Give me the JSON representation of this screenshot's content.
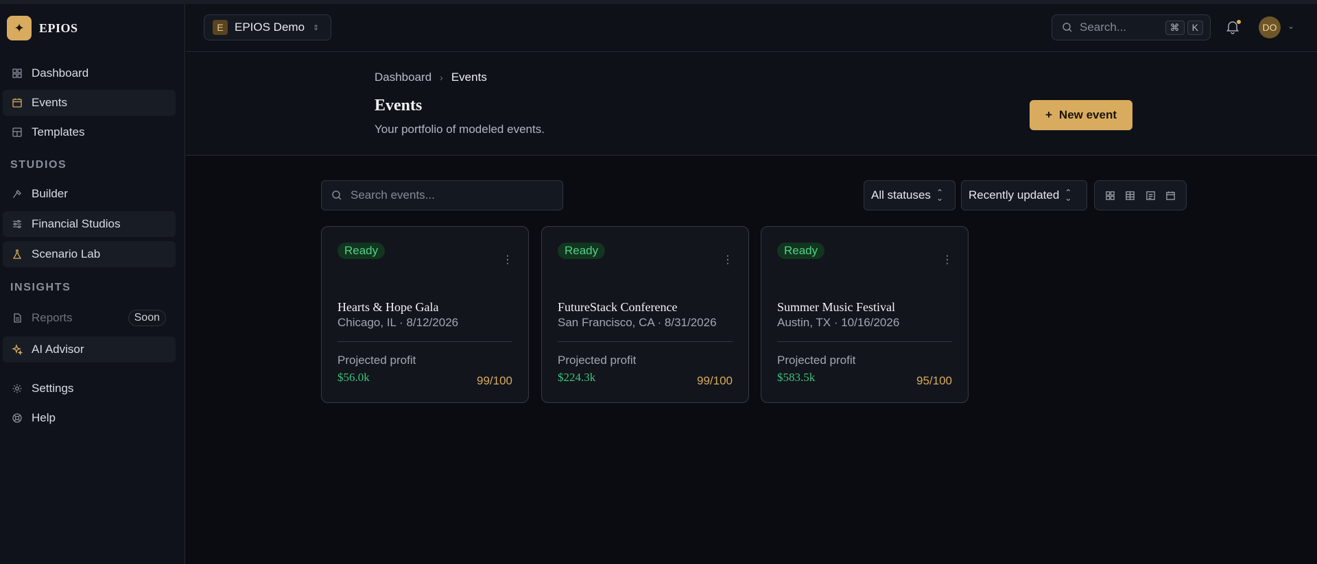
{
  "brand": {
    "logo_glyph": "✦",
    "name": "EPIOS"
  },
  "sidebar": {
    "items_top": [
      {
        "label": "Dashboard",
        "icon": "dashboard-icon"
      },
      {
        "label": "Events",
        "icon": "calendar-icon",
        "active": true
      },
      {
        "label": "Templates",
        "icon": "template-icon"
      }
    ],
    "studios_label": "STUDIOS",
    "studios": [
      {
        "label": "Builder",
        "icon": "hammer-icon"
      },
      {
        "label": "Financial Studios",
        "icon": "sliders-icon",
        "active": true
      },
      {
        "label": "Scenario Lab",
        "icon": "flask-icon",
        "active": true
      }
    ],
    "insights_label": "INSIGHTS",
    "insights": [
      {
        "label": "Reports",
        "icon": "report-icon",
        "badge": "Soon",
        "disabled": true
      },
      {
        "label": "AI Advisor",
        "icon": "sparkle-icon",
        "active": true
      }
    ],
    "bottom": [
      {
        "label": "Settings",
        "icon": "gear-icon"
      },
      {
        "label": "Help",
        "icon": "lifebuoy-icon"
      }
    ]
  },
  "header": {
    "workspace_initial": "E",
    "workspace_name": "EPIOS Demo",
    "search_placeholder": "Search...",
    "kbd_cmd": "⌘",
    "kbd_key": "K",
    "avatar_initials": "DO"
  },
  "page": {
    "breadcrumb_root": "Dashboard",
    "breadcrumb_current": "Events",
    "title": "Events",
    "subtitle": "Your portfolio of modeled events.",
    "new_button": "New event"
  },
  "toolbar": {
    "search_placeholder": "Search events...",
    "status_filter": "All statuses",
    "sort": "Recently updated"
  },
  "events": [
    {
      "status": "Ready",
      "title": "Hearts & Hope Gala",
      "meta": "Chicago, IL · 8/12/2026",
      "profit_label": "Projected profit",
      "profit": "$56.0k",
      "score": "99/100"
    },
    {
      "status": "Ready",
      "title": "FutureStack Conference",
      "meta": "San Francisco, CA · 8/31/2026",
      "profit_label": "Projected profit",
      "profit": "$224.3k",
      "score": "99/100"
    },
    {
      "status": "Ready",
      "title": "Summer Music Festival",
      "meta": "Austin, TX · 10/16/2026",
      "profit_label": "Projected profit",
      "profit": "$583.5k",
      "score": "95/100"
    }
  ],
  "colors": {
    "accent": "#d8ab5e",
    "status_ready": "#4fd187",
    "profit": "#3ec27a",
    "background": "#0a0c11"
  }
}
